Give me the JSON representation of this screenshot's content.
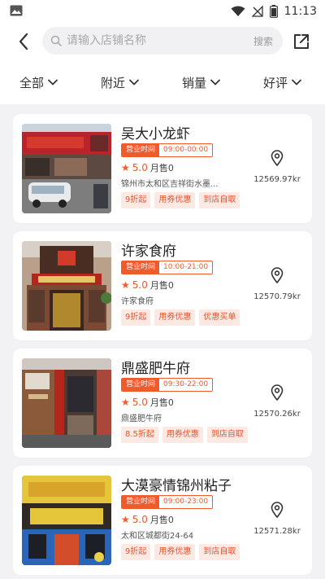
{
  "status_bar": {
    "time": "11:13"
  },
  "header": {
    "search_placeholder": "请输入店铺名称",
    "search_button": "搜索"
  },
  "filters": [
    {
      "label": "全部"
    },
    {
      "label": "附近"
    },
    {
      "label": "销量"
    },
    {
      "label": "好评"
    }
  ],
  "colors": {
    "accent": "#ef5b2b",
    "tag_bg": "#fde9e4",
    "page_bg": "#f2f2f4"
  },
  "stores": [
    {
      "name": "吴大小龙虾",
      "hours_label": "营业时间",
      "hours": "09:00-00:00",
      "rating": "5.0",
      "monthly_sales": "月售0",
      "address": "锦州市太和区吉祥街水墨...",
      "distance": "12569.97kr",
      "tags": [
        "9折起",
        "用券优惠",
        "到店自取"
      ]
    },
    {
      "name": "许家食府",
      "hours_label": "营业时间",
      "hours": "10:00-21:00",
      "rating": "5.0",
      "monthly_sales": "月售0",
      "address": "许家食府",
      "distance": "12570.79kr",
      "tags": [
        "9折起",
        "用券优惠",
        "优惠买单"
      ]
    },
    {
      "name": "鼎盛肥牛府",
      "hours_label": "营业时间",
      "hours": "09:30-22:00",
      "rating": "5.0",
      "monthly_sales": "月售0",
      "address": "鼎盛肥牛府",
      "distance": "12570.26kr",
      "tags": [
        "8.5折起",
        "用券优惠",
        "到店自取"
      ]
    },
    {
      "name": "大漠豪情锦州粘子",
      "hours_label": "营业时间",
      "hours": "09:00-23:00",
      "rating": "5.0",
      "monthly_sales": "月售0",
      "address": "太和区城都街24-64",
      "distance": "12571.28kr",
      "tags": [
        "9折起",
        "用券优惠",
        "到店自取"
      ]
    }
  ]
}
